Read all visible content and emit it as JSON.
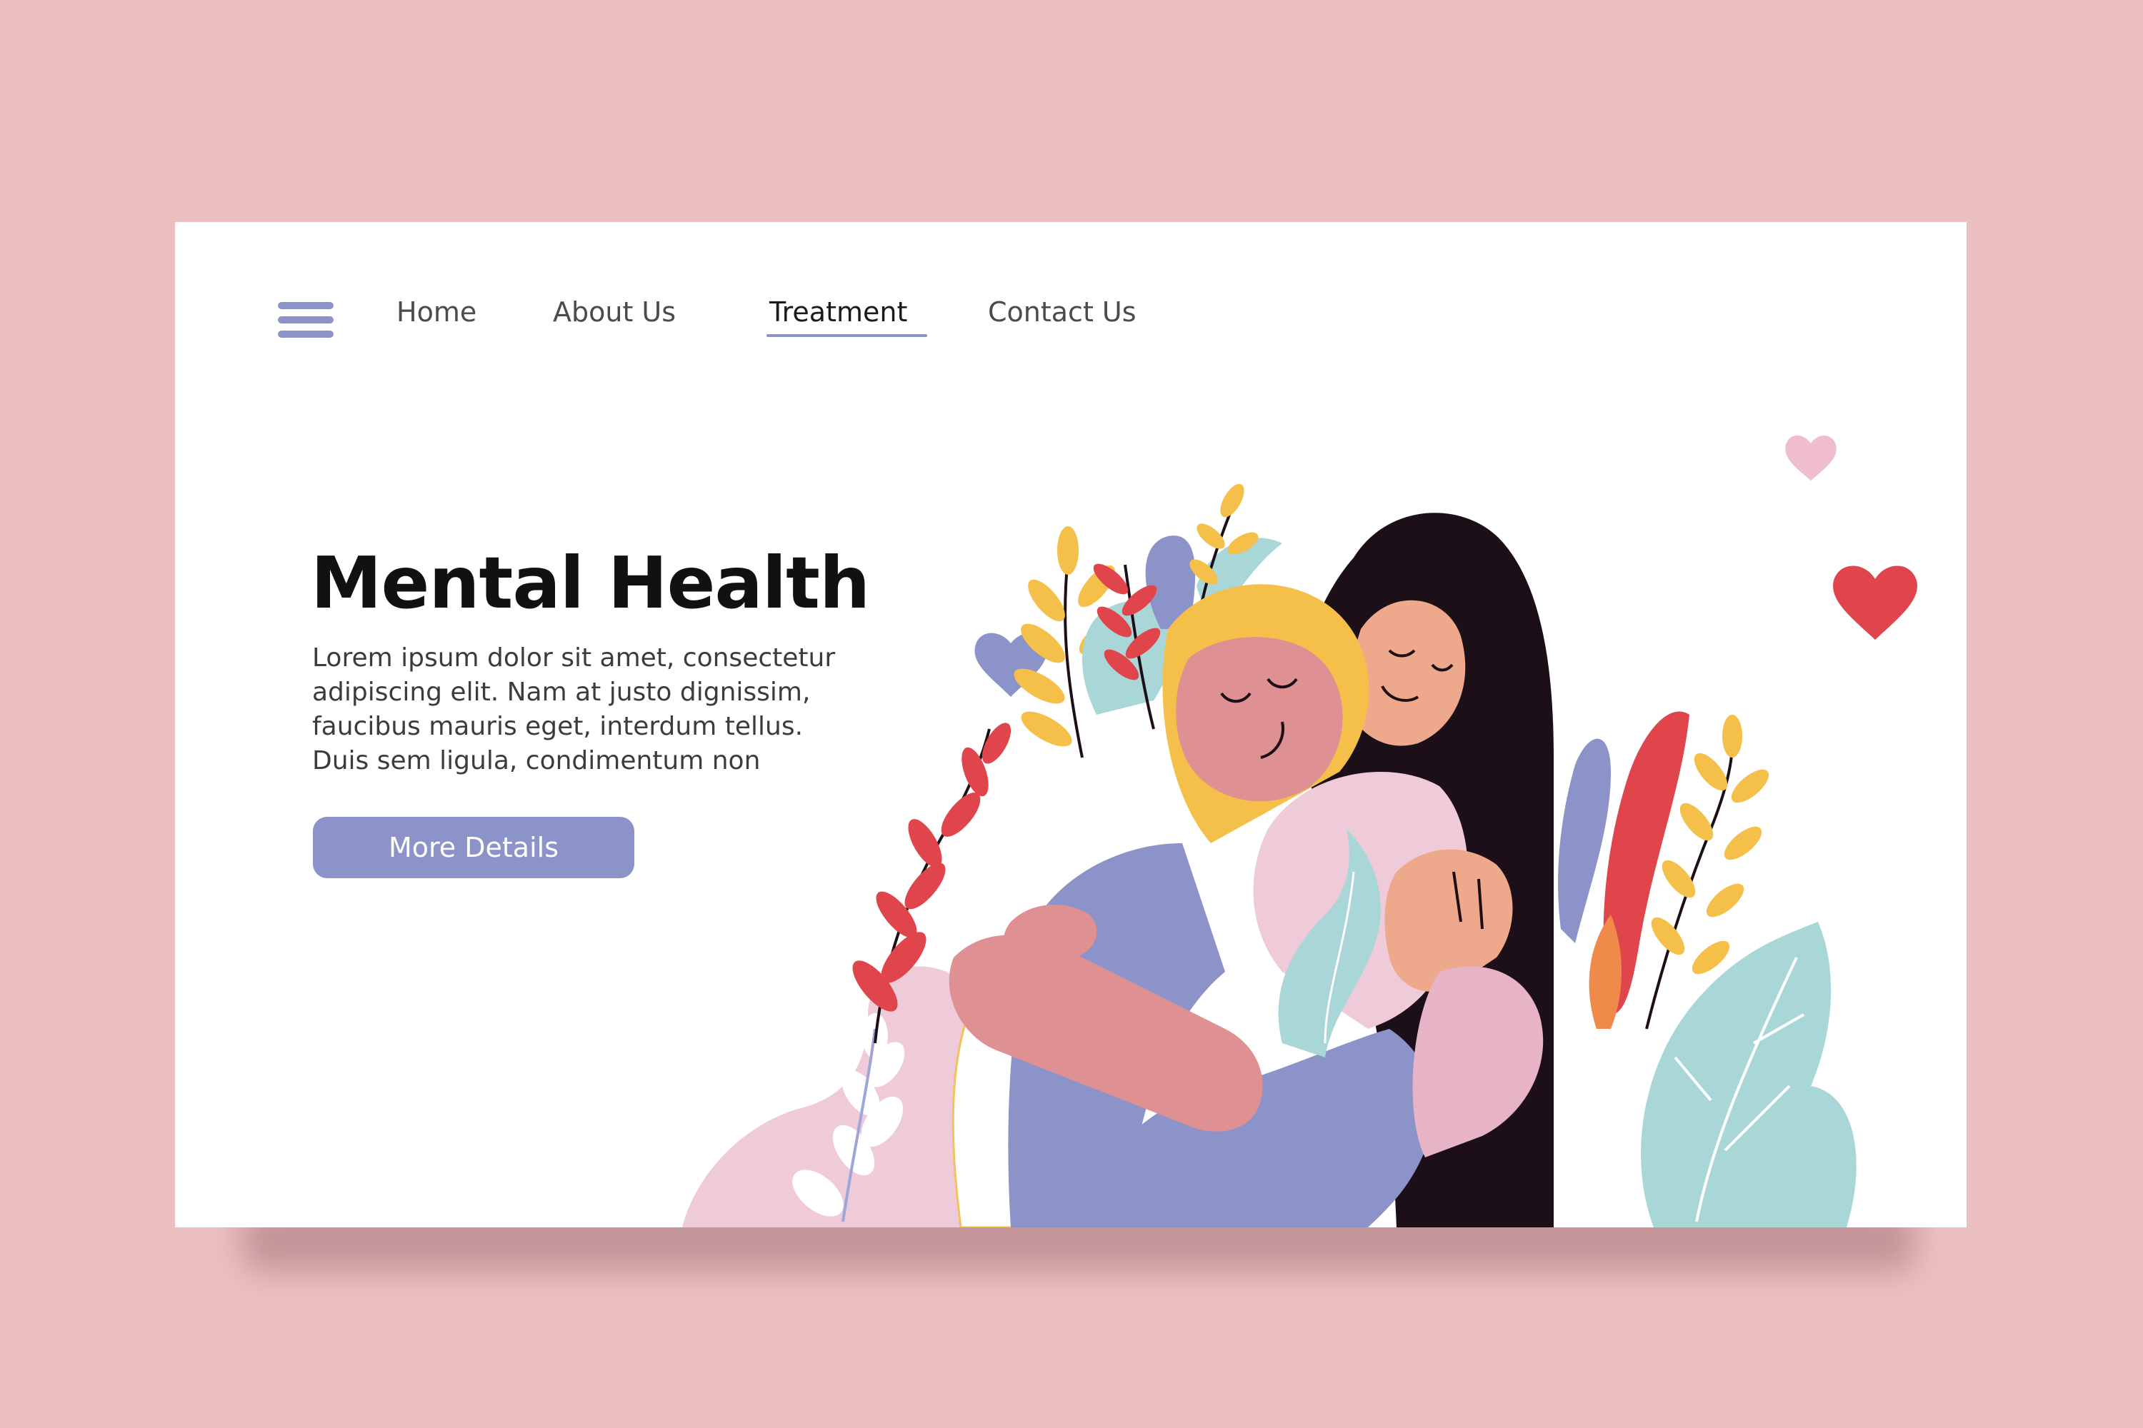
{
  "nav": {
    "menu_icon": "hamburger-menu-icon",
    "items": [
      {
        "label": "Home",
        "active": false
      },
      {
        "label": "About Us",
        "active": false
      },
      {
        "label": "Treatment",
        "active": true
      },
      {
        "label": "Contact Us",
        "active": false
      }
    ]
  },
  "hero": {
    "title": "Mental Health",
    "body_lines": [
      "Lorem ipsum dolor sit amet, consectetur",
      "adipiscing elit. Nam at justo dignissim,",
      "faucibus mauris eget, interdum tellus.",
      "Duis sem ligula, condimentum non"
    ],
    "button_label": "More Details"
  },
  "illustration": {
    "subject": "two-people-hugging-illustration",
    "hearts": [
      "heart-icon-pink",
      "heart-icon-red",
      "heart-icon-lavender"
    ]
  },
  "colors": {
    "page_background": "#ecbfc1",
    "card_background": "#ffffff",
    "accent": "#8b93c9",
    "title_text": "#111111",
    "body_text": "#3c3c3c",
    "nav_text": "#4b4b4b"
  }
}
